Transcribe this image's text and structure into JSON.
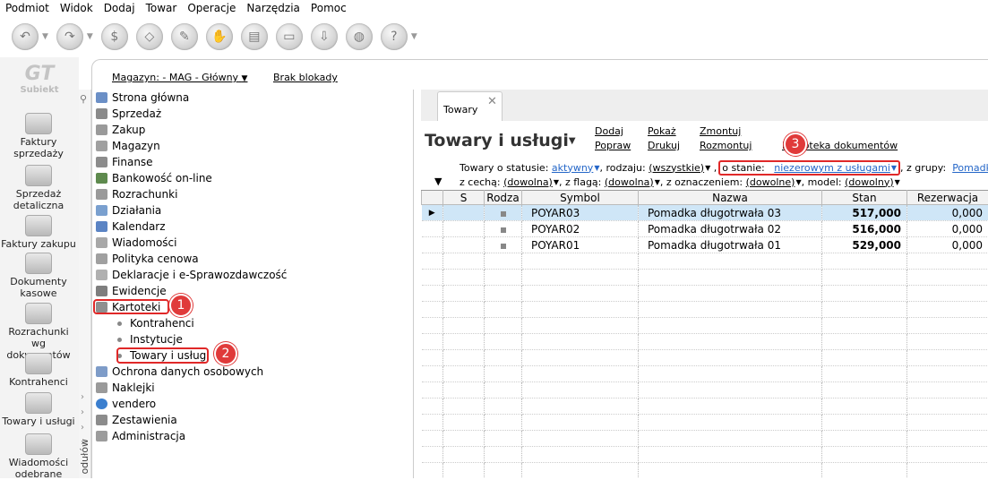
{
  "menu": [
    "Podmiot",
    "Widok",
    "Dodaj",
    "Towar",
    "Operacje",
    "Narzędzia",
    "Pomoc"
  ],
  "toolbar_icons": [
    "back-arrow-icon",
    "forward-arrow-icon",
    "money-icon",
    "tag-icon",
    "edit-tag-icon",
    "hand-coin-icon",
    "printer-icon",
    "cards-icon",
    "download-icon",
    "globe-icon",
    "help-icon"
  ],
  "logo": {
    "text": "Subiekt"
  },
  "left_modules": [
    {
      "label": "Faktury sprzedaży"
    },
    {
      "label": "Sprzedaż detaliczna"
    },
    {
      "label": "Faktury zakupu"
    },
    {
      "label": "Dokumenty kasowe"
    },
    {
      "label": "Rozrachunki wg dokumentów"
    },
    {
      "label": "Kontrahenci"
    },
    {
      "label": "Towary i usługi"
    },
    {
      "label": "Wiadomości odebrane"
    }
  ],
  "module_column_label": "odułów",
  "top": {
    "magazyn": "Magazyn: - MAG - Główny",
    "blokada": "Brak blokady"
  },
  "tree": [
    "Strona główna",
    "Sprzedaż",
    "Zakup",
    "Magazyn",
    "Finanse",
    "Bankowość on-line",
    "Rozrachunki",
    "Działania",
    "Kalendarz",
    "Wiadomości",
    "Polityka cenowa",
    "Deklaracje i e-Sprawozdawczość",
    "Ewidencje",
    "Kartoteki"
  ],
  "tree_sub": [
    "Kontrahenci",
    "Instytucje",
    "Towary i usługi"
  ],
  "tree_after": [
    "Ochrona danych osobowych",
    "Naklejki",
    "vendero",
    "Zestawienia",
    "Administracja"
  ],
  "badges": [
    "1",
    "2",
    "3"
  ],
  "tab": {
    "label": "Towary",
    "close": "✕"
  },
  "page_title": "Towary i usługi",
  "actions": [
    "Dodaj",
    "Popraw",
    "Pokaż",
    "Drukuj",
    "Zmontuj",
    "Rozmontuj",
    "Biblioteka dokumentów"
  ],
  "filters": {
    "row1": {
      "status_label": "Towary o statusie:",
      "status_value": "aktywny",
      "rodzaj_label": ", rodzaju:",
      "rodzaj_value": "(wszystkie)",
      "stan_label": "o stanie:",
      "stan_value": "niezerowym z usługami",
      "grupy_label": ", z grupy:",
      "grupy_value": "Pomadki"
    },
    "row2": {
      "cecha_label": "z cechą:",
      "cecha_value": "(dowolna)",
      "flaga_label": ", z flagą:",
      "flaga_value": "(dowolna)",
      "oznaczenie_label": ", z oznaczeniem:",
      "oznaczenie_value": "(dowolne)",
      "model_label": ", model:",
      "model_value": "(dowolny)"
    }
  },
  "table": {
    "headers": [
      "S",
      "Rodza",
      "Symbol",
      "Nazwa",
      "Stan",
      "Rezerwacja"
    ],
    "rows": [
      {
        "symbol": "POYAR03",
        "nazwa": "Pomadka długotrwała 03",
        "stan": "517,000",
        "rezerwacja": "0,000"
      },
      {
        "symbol": "POYAR02",
        "nazwa": "Pomadka długotrwała 02",
        "stan": "516,000",
        "rezerwacja": "0,000"
      },
      {
        "symbol": "POYAR01",
        "nazwa": "Pomadka długotrwała 01",
        "stan": "529,000",
        "rezerwacja": "0,000"
      }
    ]
  },
  "colors": {
    "highlight": "#e02828",
    "link": "#2466c8",
    "selected_row": "#cfe6f7"
  }
}
